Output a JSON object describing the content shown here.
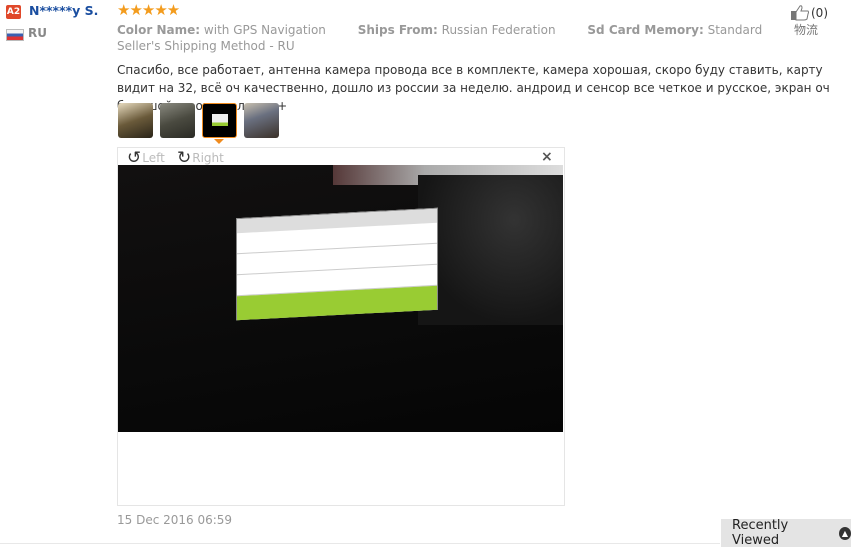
{
  "reviewer": {
    "badge": "A2",
    "name": "N*****y S.",
    "country": "RU",
    "rating": 5,
    "stars": "★★★★★"
  },
  "like": {
    "count": "(0)"
  },
  "attributes": [
    {
      "label": "Color Name:",
      "value": "with GPS Navigation"
    },
    {
      "label": "Ships From:",
      "value": "Russian Federation"
    },
    {
      "label": "Sd Card Memory:",
      "value": "Standard"
    },
    {
      "label": "物流",
      "value": "Seller's Shipping Method - RU"
    }
  ],
  "review_text": "Спасибо, все работает, антенна камера провода все в комплекте, камера хорошая, скоро буду ставить, карту видит на 32, всё оч качественно, дошло из россии за неделю. андроид и сенсор все четкое и русское, экран оч большой не ожидал, это +",
  "viewer": {
    "left_label": "Left",
    "right_label": "Right",
    "close": "×",
    "selected_thumb": 3
  },
  "date": "15 Dec 2016 06:59",
  "recently_viewed": "Recently Viewed",
  "colors": {
    "accent": "#f08b1e",
    "name": "#1a4ea0",
    "badge": "#e0482a"
  }
}
